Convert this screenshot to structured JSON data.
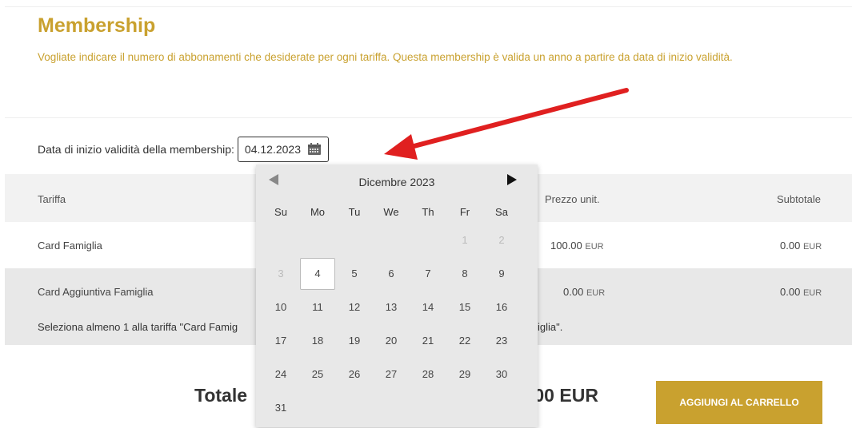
{
  "header": {
    "title": "Membership",
    "description": "Vogliate indicare il numero di abbonamenti che desiderate per ogni tariffa. Questa membership è valida un anno a partire da data di inizio validità."
  },
  "date": {
    "label": "Data di inizio validità della membership:",
    "value": "04.12.2023",
    "icon": "calendar-icon"
  },
  "table": {
    "headers": {
      "tariff": "Tariffa",
      "unit_price": "Prezzo unit.",
      "subtotal": "Subtotale"
    },
    "rows": [
      {
        "name": "Card Famiglia",
        "unit_price": "100.00",
        "unit_cur": "EUR",
        "subtotal": "0.00",
        "subtotal_cur": "EUR"
      },
      {
        "name": "Card Aggiuntiva Famiglia",
        "unit_price": "0.00",
        "unit_cur": "EUR",
        "subtotal": "0.00",
        "subtotal_cur": "EUR"
      }
    ],
    "note_visible_left": "Seleziona almeno 1 alla tariffa \"Card Famig",
    "note_visible_right": "iglia\"."
  },
  "total": {
    "label_visible": "Totale",
    "value_visible": ".00 EUR"
  },
  "actions": {
    "add_to_cart": "AGGIUNGI AL CARRELLO"
  },
  "calendar": {
    "month_label": "Dicembre 2023",
    "weekdays": [
      "Su",
      "Mo",
      "Tu",
      "We",
      "Th",
      "Fr",
      "Sa"
    ],
    "weeks": [
      [
        "",
        "",
        "",
        "",
        "",
        "1",
        "2"
      ],
      [
        "3",
        "4",
        "5",
        "6",
        "7",
        "8",
        "9"
      ],
      [
        "10",
        "11",
        "12",
        "13",
        "14",
        "15",
        "16"
      ],
      [
        "17",
        "18",
        "19",
        "20",
        "21",
        "22",
        "23"
      ],
      [
        "24",
        "25",
        "26",
        "27",
        "28",
        "29",
        "30"
      ],
      [
        "31",
        "",
        "",
        "",
        "",
        "",
        ""
      ]
    ],
    "selected": "4",
    "disabled": [
      "1",
      "2",
      "3"
    ]
  },
  "colors": {
    "accent": "#c9a12f",
    "arrow": "#e02020"
  }
}
